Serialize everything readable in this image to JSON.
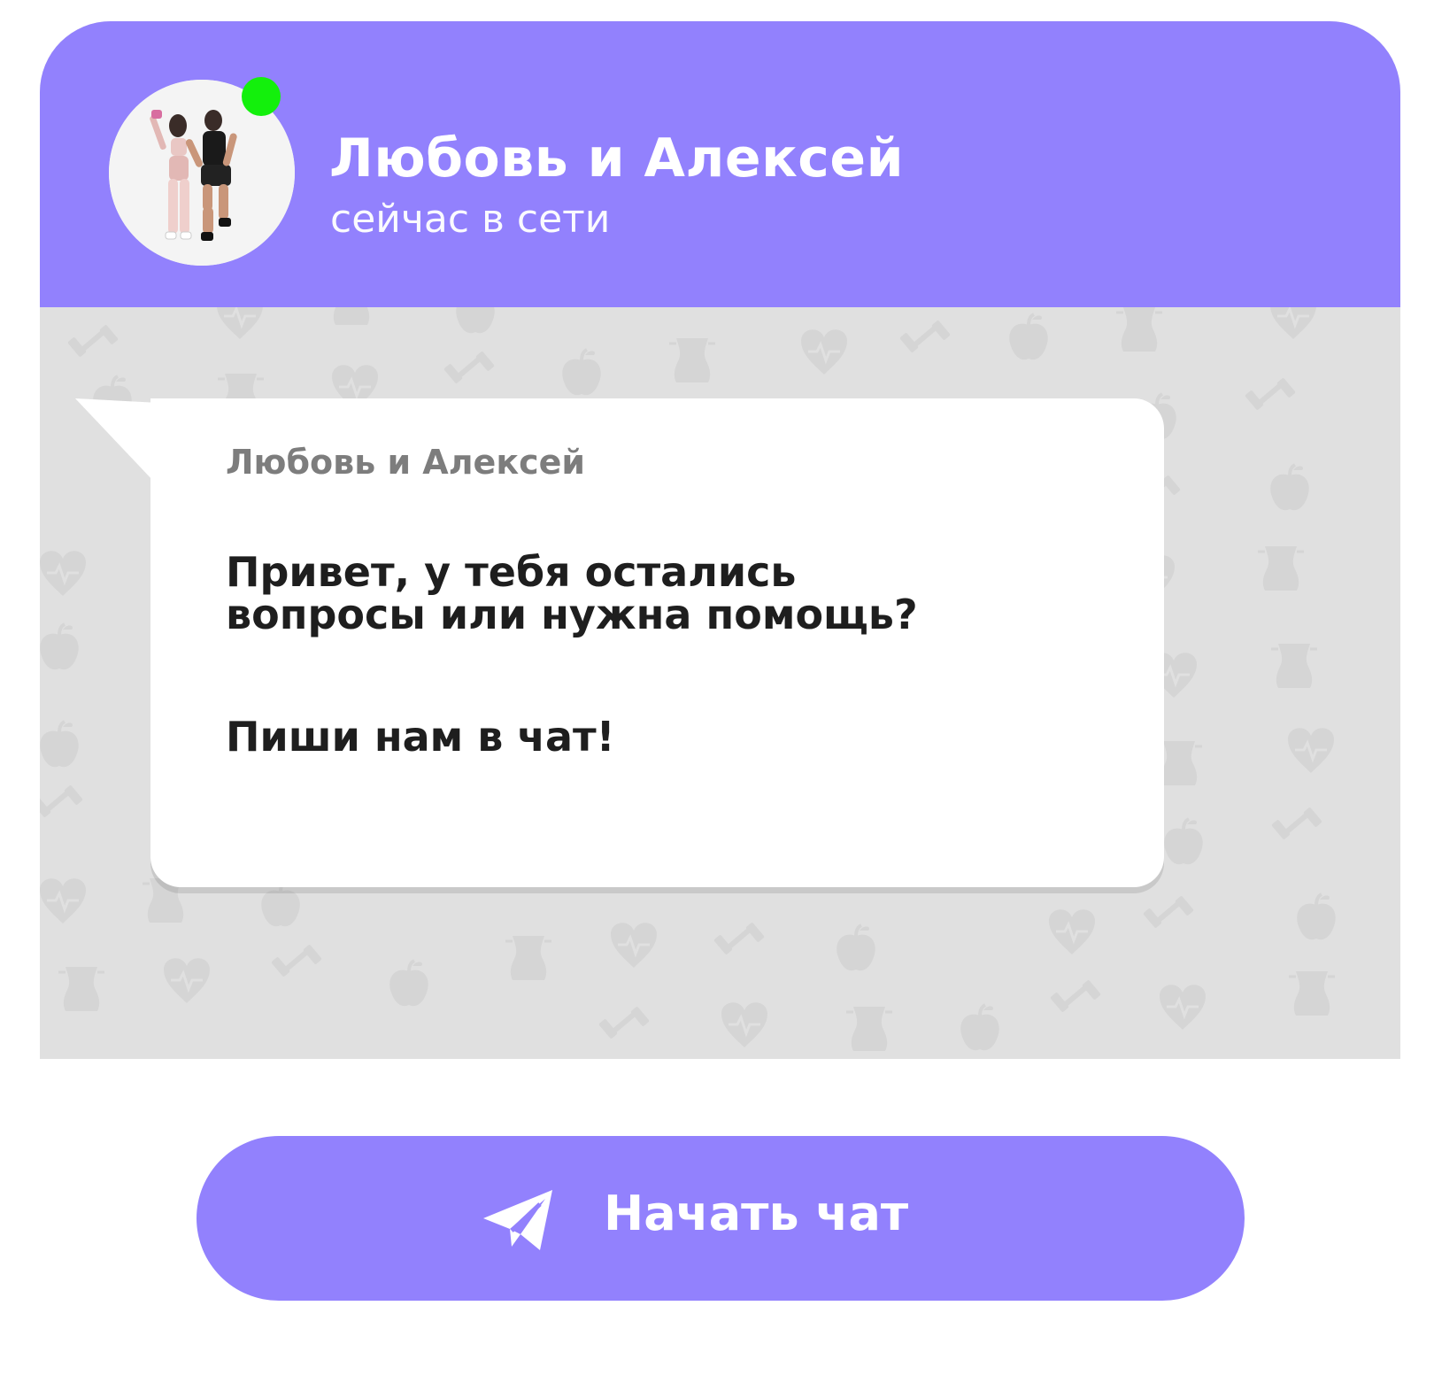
{
  "colors": {
    "accent": "#9281fd",
    "online": "#13f00c",
    "chat_background": "#e0e0e0",
    "bubble": "#ffffff",
    "message_text": "#1e1e1e",
    "sender_text": "#7d7d7d"
  },
  "header": {
    "contact_name": "Любовь и Алексей",
    "status": "сейчас в сети",
    "avatar_icon": "avatar-photo",
    "online_indicator": "online-dot"
  },
  "message": {
    "sender": "Любовь и Алексей",
    "text": "Привет, у тебя остались\nвопросы или нужна помощь?",
    "cta": "Пиши нам в чат!"
  },
  "background_pattern": {
    "icons": [
      "heart-pulse-icon",
      "apple-icon",
      "dumbbell-icon",
      "waist-icon"
    ]
  },
  "start_chat_button": {
    "label": "Начать чат",
    "icon": "paper-plane-icon"
  }
}
